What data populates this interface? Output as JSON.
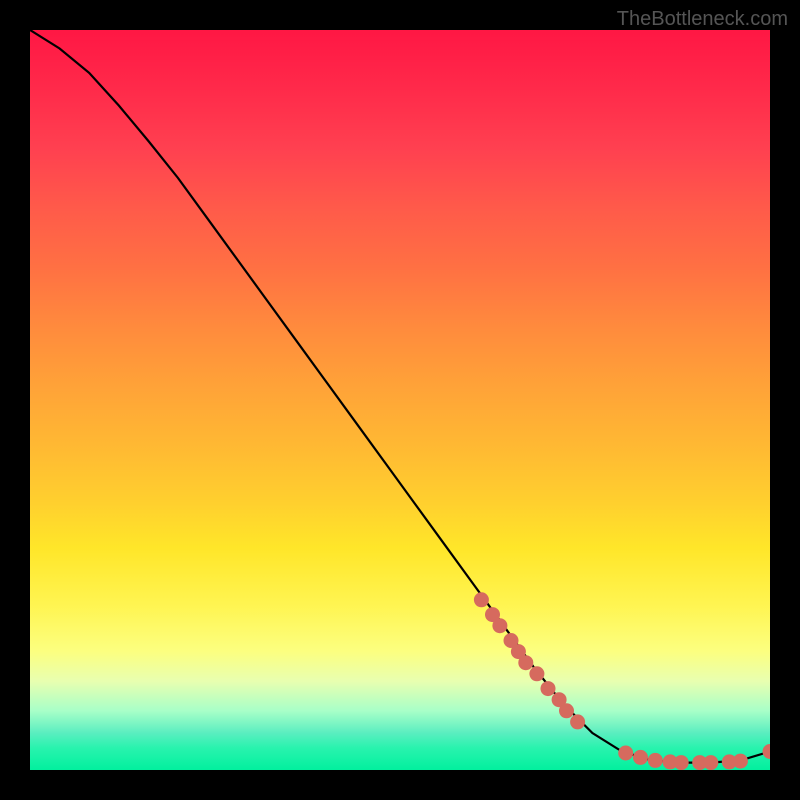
{
  "watermark": "TheBottleneck.com",
  "colors": {
    "dot": "#d66a5e",
    "curve": "#000000",
    "page_bg": "#000000"
  },
  "chart_data": {
    "type": "line",
    "title": "",
    "xlabel": "",
    "ylabel": "",
    "xlim": [
      0,
      100
    ],
    "ylim": [
      0,
      100
    ],
    "grid": false,
    "legend": false,
    "series": [
      {
        "name": "curve",
        "kind": "line",
        "x": [
          0,
          4,
          8,
          12,
          16,
          20,
          24,
          28,
          32,
          36,
          40,
          44,
          48,
          52,
          56,
          60,
          64,
          68,
          72,
          76,
          80,
          84,
          88,
          92,
          96,
          100
        ],
        "y": [
          100,
          97.5,
          94.2,
          89.8,
          85,
          80,
          74.5,
          69,
          63.5,
          58,
          52.5,
          47,
          41.5,
          36,
          30.5,
          25,
          19.5,
          14,
          9,
          5,
          2.5,
          1.3,
          1.0,
          1.0,
          1.3,
          2.5
        ]
      },
      {
        "name": "dots",
        "kind": "scatter",
        "x": [
          61,
          62.5,
          63.5,
          65,
          66,
          67,
          68.5,
          70,
          71.5,
          72.5,
          74,
          80.5,
          82.5,
          84.5,
          86.5,
          88,
          90.5,
          92,
          94.5,
          96,
          100
        ],
        "y": [
          23,
          21,
          19.5,
          17.5,
          16,
          14.5,
          13,
          11,
          9.5,
          8,
          6.5,
          2.3,
          1.7,
          1.3,
          1.1,
          1.0,
          1.0,
          1.0,
          1.1,
          1.2,
          2.5
        ]
      }
    ]
  }
}
